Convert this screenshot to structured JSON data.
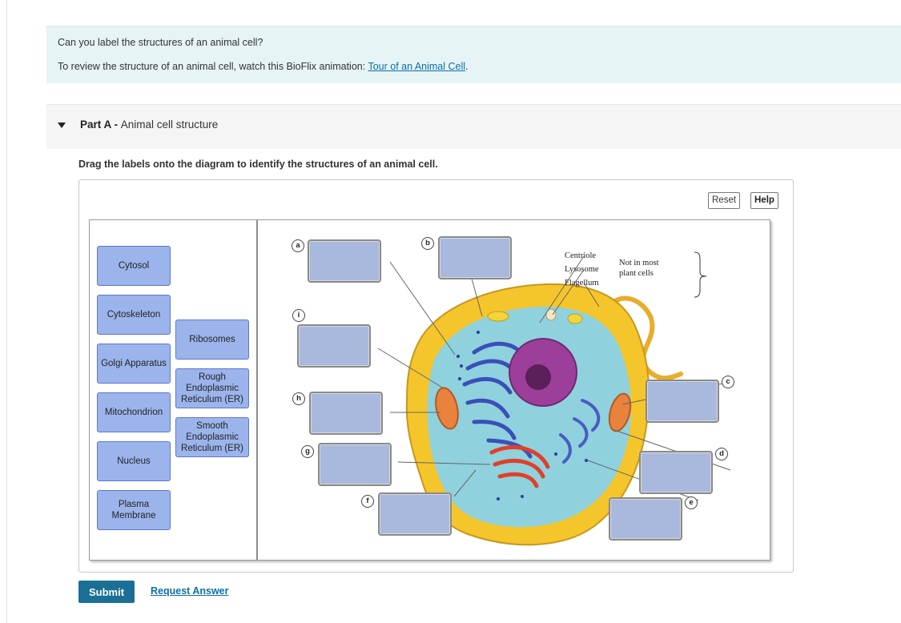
{
  "intro": {
    "question": "Can you label the structures of an animal cell?",
    "review_prefix": "To review the structure of an animal cell, watch this BioFlix animation: ",
    "review_link": "Tour of an Animal Cell",
    "review_suffix": "."
  },
  "part": {
    "prefix": "Part A",
    "separator": " - ",
    "title": "Animal cell structure"
  },
  "instruction": "Drag the labels onto the diagram to identify the structures of an animal cell.",
  "toolbar": {
    "reset_label": "Reset",
    "help_label": "Help"
  },
  "labels": [
    "Cytosol",
    "Cytoskeleton",
    "Ribosomes",
    "Golgi Apparatus",
    "Rough Endoplasmic Reticulum (ER)",
    "Mitochondrion",
    "Smooth Endoplasmic Reticulum (ER)",
    "Nucleus",
    "Plasma Membrane"
  ],
  "targets": [
    "a",
    "b",
    "i",
    "h",
    "g",
    "f",
    "c",
    "d",
    "e"
  ],
  "diagram_annotations": {
    "centriole": "Centriole",
    "lysosome": "Lysosome",
    "flagellum": "Flagellum",
    "not_in_plant_line1": "Not in most",
    "not_in_plant_line2": "plant cells"
  },
  "footer": {
    "submit_label": "Submit",
    "request_label": "Request Answer"
  },
  "colors": {
    "label_fill": "#9cb4ec",
    "target_fill": "#a9b9de",
    "submit": "#1b6f94",
    "link": "#0b6fa6",
    "intro_bg": "#e6f4f5"
  }
}
